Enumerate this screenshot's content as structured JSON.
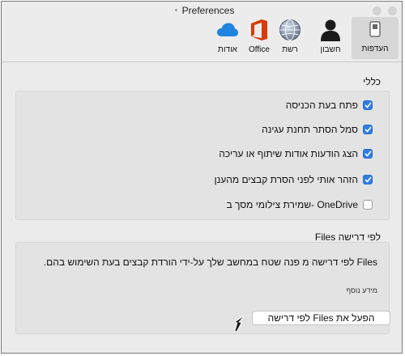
{
  "window": {
    "title": "Preferences"
  },
  "tabs": [
    {
      "label": "העדפות",
      "icon": "switch-icon"
    },
    {
      "label": "חשבון",
      "icon": "person-icon"
    },
    {
      "label": "רשת",
      "icon": "globe-icon"
    },
    {
      "label": "Office",
      "icon": "office-icon"
    },
    {
      "label": "אודות",
      "icon": "cloud-icon"
    }
  ],
  "general": {
    "title": "כללי",
    "options": [
      {
        "label": "פתח בעת הכניסה",
        "checked": true
      },
      {
        "label": "סמל הסתר תחנת עגינה",
        "checked": true
      },
      {
        "label": "הצג הודעות אודות שיתוף או עריכה",
        "checked": true
      },
      {
        "label": "הזהר אותי לפני הסרת קבצים מהענן",
        "checked": true
      },
      {
        "label": "שמירת צילומי מסך ב- OneDrive",
        "checked": false
      }
    ]
  },
  "files_on_demand": {
    "title": "Files לפי דרישה",
    "description": "Files לפי דרישה מ פנה שטח במחשב שלך על-ידי הורדת קבצים בעת השימוש בהם.",
    "more_info": "מידע נוסף",
    "button_label": "הפעל את Files לפי דרישה"
  },
  "colors": {
    "accent": "#2d7de8",
    "office": "#d83b01",
    "cloud": "#1f83e0"
  }
}
